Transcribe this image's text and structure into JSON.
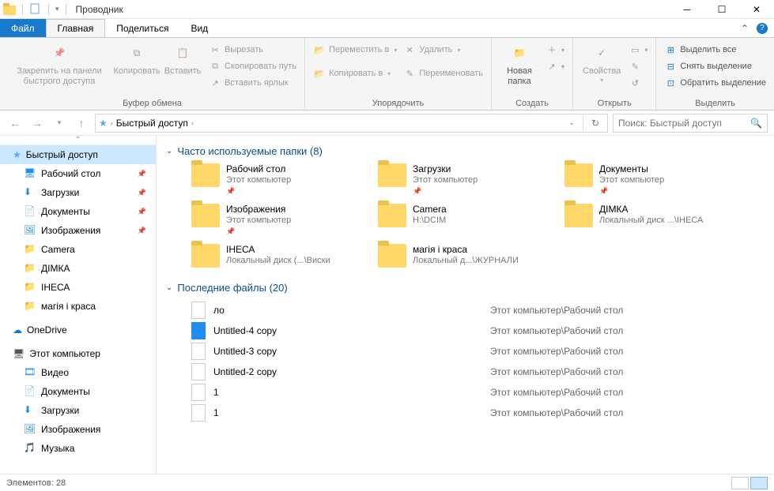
{
  "window": {
    "title": "Проводник"
  },
  "tabs": {
    "file": "Файл",
    "home": "Главная",
    "share": "Поделиться",
    "view": "Вид"
  },
  "ribbon": {
    "clipboard": {
      "pin": "Закрепить на панели быстрого доступа",
      "copy": "Копировать",
      "paste": "Вставить",
      "cut": "Вырезать",
      "copy_path": "Скопировать путь",
      "paste_shortcut": "Вставить ярлык",
      "label": "Буфер обмена"
    },
    "organize": {
      "move_to": "Переместить в",
      "copy_to": "Копировать в",
      "delete": "Удалить",
      "rename": "Переименовать",
      "label": "Упорядочить"
    },
    "create": {
      "new_folder": "Новая папка",
      "label": "Создать"
    },
    "open": {
      "properties": "Свойства",
      "label": "Открыть"
    },
    "select": {
      "select_all": "Выделить все",
      "select_none": "Снять выделение",
      "invert": "Обратить выделение",
      "label": "Выделить"
    }
  },
  "breadcrumb": {
    "root": "Быстрый доступ"
  },
  "search": {
    "placeholder": "Поиск: Быстрый доступ"
  },
  "tree": {
    "quick": "Быстрый доступ",
    "items": [
      {
        "label": "Рабочий стол"
      },
      {
        "label": "Загрузки"
      },
      {
        "label": "Документы"
      },
      {
        "label": "Изображения"
      },
      {
        "label": "Camera"
      },
      {
        "label": "ДІМКА"
      },
      {
        "label": "ІНЕСА"
      },
      {
        "label": "магія і краса"
      }
    ],
    "onedrive": "OneDrive",
    "thispc": "Этот компьютер",
    "pc_items": [
      {
        "label": "Видео"
      },
      {
        "label": "Документы"
      },
      {
        "label": "Загрузки"
      },
      {
        "label": "Изображения"
      },
      {
        "label": "Музыка"
      }
    ]
  },
  "sections": {
    "freq": "Часто используемые папки (8)",
    "recent": "Последние файлы (20)"
  },
  "folders": [
    {
      "name": "Рабочий стол",
      "path": "Этот компьютер"
    },
    {
      "name": "Загрузки",
      "path": "Этот компьютер"
    },
    {
      "name": "Документы",
      "path": "Этот компьютер"
    },
    {
      "name": "Изображения",
      "path": "Этот компьютер"
    },
    {
      "name": "Camera",
      "path": "H:\\DCIM"
    },
    {
      "name": "ДІМКА",
      "path": "Локальный диск ...\\ІНЕСА"
    },
    {
      "name": "ІНЕСА",
      "path": "Локальный диск (...\\Виски"
    },
    {
      "name": "магія і краса",
      "path": "Локальный д...\\ЖУРНАЛИ"
    }
  ],
  "recent_files": [
    {
      "name": "ло",
      "path": "Этот компьютер\\Рабочий стол",
      "blue": false
    },
    {
      "name": "Untitled-4 copy",
      "path": "Этот компьютер\\Рабочий стол",
      "blue": true
    },
    {
      "name": "Untitled-3 copy",
      "path": "Этот компьютер\\Рабочий стол",
      "blue": false
    },
    {
      "name": "Untitled-2 copy",
      "path": "Этот компьютер\\Рабочий стол",
      "blue": false
    },
    {
      "name": "1",
      "path": "Этот компьютер\\Рабочий стол",
      "blue": false
    },
    {
      "name": "1",
      "path": "Этот компьютер\\Рабочий стол",
      "blue": false
    }
  ],
  "status": {
    "items": "Элементов: 28"
  }
}
